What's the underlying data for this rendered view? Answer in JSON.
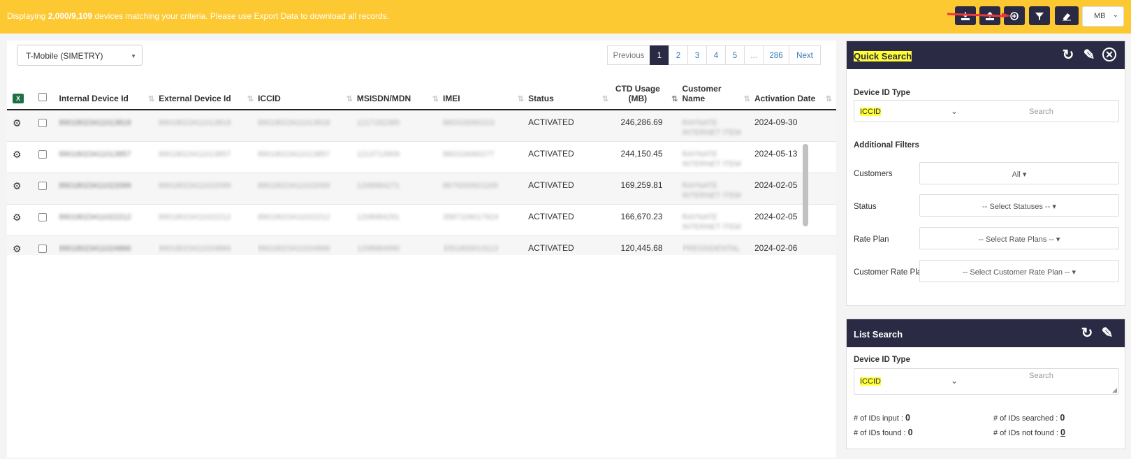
{
  "topbar": {
    "msg_prefix": "Displaying ",
    "msg_count": "2,000/9,109",
    "msg_suffix": " devices matching your criteria. Please use Export Data to download all records.",
    "unit": "MB"
  },
  "toolbar_icons": [
    "download-icon",
    "upload-icon",
    "export-icon",
    "filter-icon",
    "eraser-icon"
  ],
  "carrier_select": "T-Mobile (SIMETRY)",
  "pagination": {
    "previous": "Previous",
    "pages": [
      "1",
      "2",
      "3",
      "4",
      "5",
      "...",
      "286"
    ],
    "active": "1",
    "next": "Next"
  },
  "table": {
    "columns": [
      "Internal Device Id",
      "External Device Id",
      "ICCID",
      "MSISDN/MDN",
      "IMEI",
      "Status",
      "CTD Usage (MB)",
      "Customer Name",
      "Activation Date"
    ],
    "ctd_line1": "CTD Usage",
    "ctd_line2": "(MB)",
    "cust_line1": "Customer",
    "cust_line2": "Name",
    "rows": [
      {
        "internal": "89018023411013818",
        "external": "89018023411013818",
        "iccid": "89018023411013818",
        "msisdn": "1217182385",
        "imei": "860316060223",
        "status": "ACTIVATED",
        "usage": "246,286.69",
        "customer_1": "RAYNATE",
        "customer_2": "INTERNET ITEM",
        "activation": "2024-09-30"
      },
      {
        "internal": "89018023411013857",
        "external": "89018023411013857",
        "iccid": "89018023411013857",
        "msisdn": "1213713909",
        "imei": "860316060277",
        "status": "ACTIVATED",
        "usage": "244,150.45",
        "customer_1": "RAYNATE",
        "customer_2": "INTERNET ITEM",
        "activation": "2024-05-13"
      },
      {
        "internal": "89018023411022099",
        "external": "89018023411022099",
        "iccid": "89018023411022099",
        "msisdn": "1208984271",
        "imei": "8679200921169",
        "status": "ACTIVATED",
        "usage": "169,259.81",
        "customer_1": "RAYNATE",
        "customer_2": "INTERNET ITEM",
        "activation": "2024-02-05"
      },
      {
        "internal": "89018023411022212",
        "external": "89018023411022212",
        "iccid": "89018023411022212",
        "msisdn": "1208984291",
        "imei": "3587109017924",
        "status": "ACTIVATED",
        "usage": "166,670.23",
        "customer_1": "RAYNATE",
        "customer_2": "INTERNET ITEM",
        "activation": "2024-02-05"
      },
      {
        "internal": "89018023411024866",
        "external": "89018023411024866",
        "iccid": "89018023411024866",
        "msisdn": "1208984990",
        "imei": "3351800013113",
        "status": "ACTIVATED",
        "usage": "120,445.68",
        "customer_1": "PRESSIDENTAL",
        "customer_2": "",
        "activation": "2024-02-06"
      }
    ]
  },
  "quick_search": {
    "title": "Quick Search",
    "device_id_type_label": "Device ID Type",
    "device_id_type": "ICCID",
    "search_placeholder": "Search",
    "additional_filters": "Additional Filters",
    "customers_label": "Customers",
    "customers_value": "All",
    "status_label": "Status",
    "status_value": "-- Select Statuses --",
    "rate_plan_label": "Rate Plan",
    "rate_plan_value": "-- Select Rate Plans --",
    "customer_rate_plan_label": "Customer Rate Plan",
    "customer_rate_plan_value": "-- Select Customer Rate Plan --"
  },
  "list_search": {
    "title": "List Search",
    "device_id_type_label": "Device ID Type",
    "device_id_type": "ICCID",
    "search_placeholder": "Search",
    "ids_input_label": "# of IDs input :",
    "ids_input": "0",
    "ids_searched_label": "# of IDs searched :",
    "ids_searched": "0",
    "ids_found_label": "# of IDs found :",
    "ids_found": "0",
    "ids_not_found_label": "# of IDs not found :",
    "ids_not_found": "0"
  },
  "colors": {
    "topbar": "#fdc933",
    "dark": "#2b2a44",
    "highlight": "#ffff33"
  }
}
